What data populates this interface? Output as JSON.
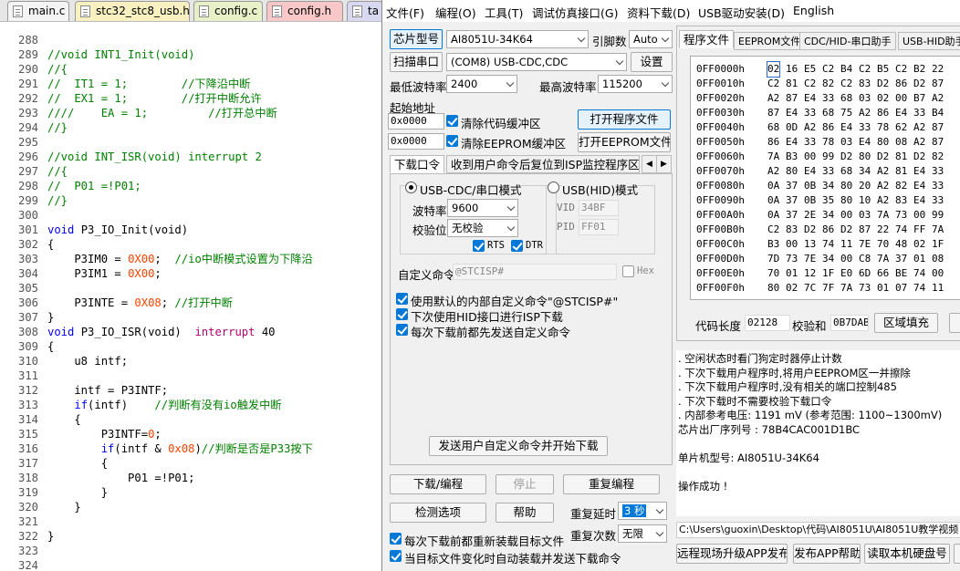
{
  "editor": {
    "tabs": [
      "main.c",
      "stc32_stc8_usb.h",
      "config.c",
      "config.h",
      "ta"
    ],
    "lines": [
      {
        "n": "288",
        "t": ""
      },
      {
        "n": "289",
        "t": "//void INT1_Init(void)",
        "c": "cm"
      },
      {
        "n": "290",
        "t": "//{",
        "c": "cm"
      },
      {
        "n": "291",
        "t": "//  IT1 = 1;        //下降沿中断",
        "c": "cm"
      },
      {
        "n": "292",
        "t": "//  EX1 = 1;        //打开中断允许",
        "c": "cm"
      },
      {
        "n": "293",
        "t": "////    EA = 1;         //打开总中断",
        "c": "cm"
      },
      {
        "n": "294",
        "t": "//}",
        "c": "cm"
      },
      {
        "n": "295",
        "t": ""
      },
      {
        "n": "296",
        "t": "//void INT_ISR(void) interrupt 2",
        "c": "cm"
      },
      {
        "n": "297",
        "t": "//{",
        "c": "cm"
      },
      {
        "n": "298",
        "t": "//  P01 =!P01;",
        "c": "cm"
      },
      {
        "n": "299",
        "t": "//}",
        "c": "cm"
      },
      {
        "n": "300",
        "t": ""
      },
      {
        "n": "301",
        "t": "void P3_IO_Init(void)",
        "c": "kwline1"
      },
      {
        "n": "302",
        "t": "{"
      },
      {
        "n": "303",
        "t": "    P3IM0 = 0X00;  //io中断模式设置为下降沿",
        "c": "asg1"
      },
      {
        "n": "304",
        "t": "    P3IM1 = 0X00;",
        "c": "asg2"
      },
      {
        "n": "305",
        "t": ""
      },
      {
        "n": "306",
        "t": "    P3INTE = 0X08; //打开中断",
        "c": "asg3"
      },
      {
        "n": "307",
        "t": "}"
      },
      {
        "n": "308",
        "t": "void P3_IO_ISR(void)  interrupt 40",
        "c": "isr"
      },
      {
        "n": "309",
        "t": "{"
      },
      {
        "n": "310",
        "t": "    u8 intf;"
      },
      {
        "n": "311",
        "t": ""
      },
      {
        "n": "312",
        "t": "    intf = P3INTF;"
      },
      {
        "n": "313",
        "t": "    if(intf)    //判断有没有io触发中断",
        "c": "if1"
      },
      {
        "n": "314",
        "t": "    {"
      },
      {
        "n": "315",
        "t": "        P3INTF=0;",
        "c": "asg4"
      },
      {
        "n": "316",
        "t": "        if(intf & 0x08)//判断是否是P33按下",
        "c": "if2"
      },
      {
        "n": "317",
        "t": "        {"
      },
      {
        "n": "318",
        "t": "            P01 =!P01;"
      },
      {
        "n": "319",
        "t": "        }"
      },
      {
        "n": "320",
        "t": "    }"
      },
      {
        "n": "321",
        "t": ""
      },
      {
        "n": "322",
        "t": "}"
      },
      {
        "n": "323",
        "t": ""
      },
      {
        "n": "324",
        "t": ""
      },
      {
        "n": "325",
        "t": ""
      }
    ]
  },
  "menu": [
    "文件(F)",
    "编程(O)",
    "工具(T)",
    "调试仿真接口(G)",
    "资料下载(D)",
    "USB驱动安装(D)",
    "English"
  ],
  "left": {
    "chip_btn": "芯片型号",
    "chip_value": "AI8051U-34K64",
    "pins_label": "引脚数",
    "pins_value": "Auto",
    "scan_btn": "扫描串口",
    "port_value": "(COM8) USB-CDC,CDC",
    "settings_btn": "设置",
    "min_baud_label": "最低波特率",
    "min_baud": "2400",
    "max_baud_label": "最高波特率",
    "max_baud": "115200",
    "start_addr_label": "起始地址",
    "addr1": "0x0000",
    "clear_code": "清除代码缓冲区",
    "open_prog": "打开程序文件",
    "addr2": "0x0000",
    "clear_eeprom": "清除EEPROM缓冲区",
    "open_eeprom": "打开EEPROM文件",
    "subtabs": [
      "下载口令",
      "收到用户命令后复位到ISP监控程序区"
    ],
    "radio_cdc": "USB-CDC/串口模式",
    "radio_hid": "USB(HID)模式",
    "baud_label": "波特率",
    "baud_value": "9600",
    "parity_label": "校验位",
    "parity_value": "无校验",
    "rts": "RTS",
    "dtr": "DTR",
    "vid_label": "VID",
    "vid": "34BF",
    "pid_label": "PID",
    "pid": "FF01",
    "custom_cmd_label": "自定义命令",
    "custom_cmd": "@STCISP#",
    "hex": "Hex",
    "opt1": "使用默认的内部自定义命令\"@STCISP#\"",
    "opt2": "下次使用HID接口进行ISP下载",
    "opt3": "每次下载前都先发送自定义命令",
    "send_btn": "发送用户自定义命令并开始下载",
    "download_btn": "下载/编程",
    "stop_btn": "停止",
    "reprog_btn": "重复编程",
    "detect_btn": "检测选项",
    "help_btn": "帮助",
    "delay_label": "重复延时",
    "delay_value": "3 秒",
    "count_label": "重复次数",
    "count_value": "无限",
    "reload_opt": "每次下载前都重新装载目标文件",
    "auto_opt": "当目标文件变化时自动装载并发送下载命令"
  },
  "right": {
    "tabs": [
      "程序文件",
      "EEPROM文件",
      "CDC/HID-串口助手",
      "USB-HID助手"
    ],
    "hex": [
      {
        "a": "0FF0000h",
        "b": [
          "02",
          "16",
          "E5",
          "C2",
          "B4",
          "C2",
          "B5",
          "C2",
          "B2",
          "22"
        ]
      },
      {
        "a": "0FF0010h",
        "b": [
          "C2",
          "81",
          "C2",
          "82",
          "C2",
          "83",
          "D2",
          "86",
          "D2",
          "87"
        ]
      },
      {
        "a": "0FF0020h",
        "b": [
          "A2",
          "87",
          "E4",
          "33",
          "68",
          "03",
          "02",
          "00",
          "B7",
          "A2"
        ]
      },
      {
        "a": "0FF0030h",
        "b": [
          "87",
          "E4",
          "33",
          "68",
          "75",
          "A2",
          "86",
          "E4",
          "33",
          "B4"
        ]
      },
      {
        "a": "0FF0040h",
        "b": [
          "68",
          "0D",
          "A2",
          "86",
          "E4",
          "33",
          "78",
          "62",
          "A2",
          "87"
        ]
      },
      {
        "a": "0FF0050h",
        "b": [
          "86",
          "E4",
          "33",
          "78",
          "03",
          "E4",
          "80",
          "08",
          "A2",
          "87"
        ]
      },
      {
        "a": "0FF0060h",
        "b": [
          "7A",
          "B3",
          "00",
          "99",
          "D2",
          "80",
          "D2",
          "81",
          "D2",
          "82"
        ]
      },
      {
        "a": "0FF0070h",
        "b": [
          "A2",
          "80",
          "E4",
          "33",
          "68",
          "34",
          "A2",
          "81",
          "E4",
          "33"
        ]
      },
      {
        "a": "0FF0080h",
        "b": [
          "0A",
          "37",
          "0B",
          "34",
          "80",
          "20",
          "A2",
          "82",
          "E4",
          "33"
        ]
      },
      {
        "a": "0FF0090h",
        "b": [
          "0A",
          "37",
          "0B",
          "35",
          "80",
          "10",
          "A2",
          "83",
          "E4",
          "33"
        ]
      },
      {
        "a": "0FF00A0h",
        "b": [
          "0A",
          "37",
          "2E",
          "34",
          "00",
          "03",
          "7A",
          "73",
          "00",
          "99"
        ]
      },
      {
        "a": "0FF00B0h",
        "b": [
          "C2",
          "83",
          "D2",
          "86",
          "D2",
          "87",
          "22",
          "74",
          "FF",
          "7A"
        ]
      },
      {
        "a": "0FF00C0h",
        "b": [
          "B3",
          "00",
          "13",
          "74",
          "11",
          "7E",
          "70",
          "48",
          "02",
          "1F"
        ]
      },
      {
        "a": "0FF00D0h",
        "b": [
          "7D",
          "73",
          "7E",
          "34",
          "00",
          "C8",
          "7A",
          "37",
          "01",
          "08"
        ]
      },
      {
        "a": "0FF00E0h",
        "b": [
          "70",
          "01",
          "12",
          "1F",
          "E0",
          "6D",
          "66",
          "BE",
          "74",
          "00"
        ]
      },
      {
        "a": "0FF00F0h",
        "b": [
          "80",
          "02",
          "7C",
          "7F",
          "7A",
          "73",
          "01",
          "07",
          "74",
          "11"
        ]
      }
    ],
    "code_len_label": "代码长度",
    "code_len": "02128",
    "checksum_label": "校验和",
    "checksum": "0B7DAB",
    "fill_btn": "区域填充",
    "log": [
      "  . 空闲状态时看门狗定时器停止计数",
      "  . 下次下载用户程序时,将用户EEPROM区一并擦除",
      "  . 下次下载用户程序时,没有相关的端口控制485",
      "  . 下次下载时不需要校验下载口令",
      "  . 内部参考电压: 1191 mV (参考范围: 1100~1300mV)",
      "芯片出厂序列号 : 78B4CAC001D1BC",
      "",
      "  单片机型号: AI8051U-34K64",
      "",
      "操作成功 !"
    ],
    "path": "C:\\Users\\guoxin\\Desktop\\代码\\AI8051U\\AI8051U教学视频",
    "bottom_btns": [
      "远程现场升级APP发布",
      "发布APP帮助",
      "读取本机硬盘号"
    ]
  }
}
